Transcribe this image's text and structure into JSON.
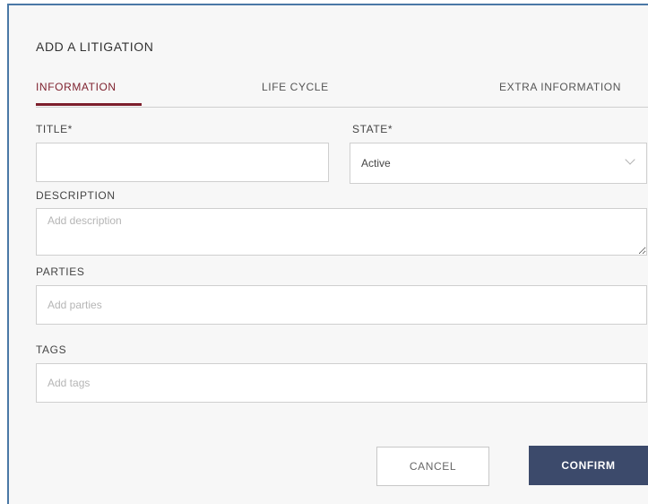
{
  "dialog": {
    "title": "ADD A LITIGATION"
  },
  "tabs": [
    {
      "label": "INFORMATION",
      "active": true
    },
    {
      "label": "LIFE CYCLE",
      "active": false
    },
    {
      "label": "EXTRA INFORMATION",
      "active": false
    }
  ],
  "form": {
    "title": {
      "label": "TITLE*",
      "value": "",
      "placeholder": ""
    },
    "state": {
      "label": "STATE*",
      "value": "Active"
    },
    "description": {
      "label": "DESCRIPTION",
      "value": "",
      "placeholder": "Add description"
    },
    "parties": {
      "label": "PARTIES",
      "value": "",
      "placeholder": "Add parties"
    },
    "tags": {
      "label": "TAGS",
      "value": "",
      "placeholder": "Add tags"
    }
  },
  "buttons": {
    "cancel": "CANCEL",
    "confirm": "CONFIRM"
  },
  "colors": {
    "accent": "#7d1f2c",
    "primary_button": "#3c4a6b",
    "dialog_border": "#4a78a6",
    "dialog_background": "#f7f7f7"
  },
  "icons": {
    "state_dropdown": "chevron-down-icon"
  }
}
